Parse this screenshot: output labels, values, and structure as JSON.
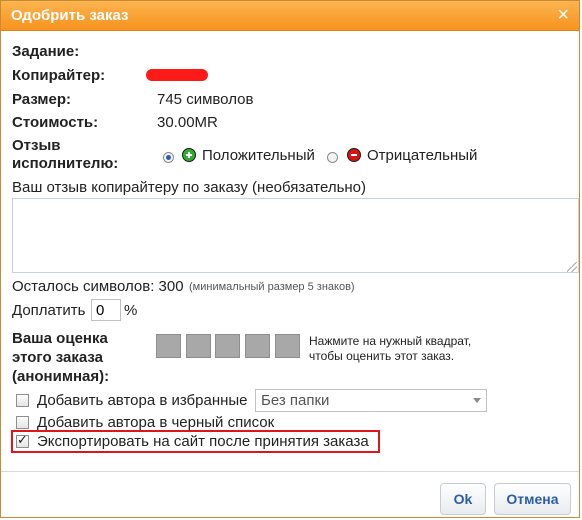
{
  "dialog": {
    "title": "Одобрить заказ",
    "close_glyph": "×"
  },
  "fields": {
    "task_label": "Задание:",
    "copywriter_label": "Копирайтер:",
    "size_label": "Размер:",
    "size_value": "745 символов",
    "cost_label": "Стоимость:",
    "cost_value": "30.00MR",
    "review_label_line1": "Отзыв",
    "review_label_line2": "исполнителю:",
    "positive_label": "Положительный",
    "negative_label": "Отрицательный",
    "review_positive_selected": true
  },
  "feedback": {
    "prompt": "Ваш отзыв копирайтеру по заказу (необязательно)",
    "value": "",
    "chars_left_label": "Осталось символов: 300",
    "chars_left_hint": "(минимальный размер 5 знаков)"
  },
  "extra_pay": {
    "label": "Доплатить",
    "value": "0",
    "unit": "%"
  },
  "rating": {
    "label_line1": "Ваша оценка",
    "label_line2": "этого заказа",
    "label_line3": "(анонимная):",
    "hint_line1": "Нажмите на нужный квадрат,",
    "hint_line2": "чтобы оценить этот заказ.",
    "squares": 5,
    "selected": 0
  },
  "options": {
    "favorites_label": "Добавить автора в избранные",
    "favorites_checked": false,
    "folder_value": "Без папки",
    "blacklist_label": "Добавить автора в черный список",
    "blacklist_checked": false,
    "export_label": "Экспортировать на сайт после принятия заказа",
    "export_checked": true
  },
  "buttons": {
    "ok": "Ok",
    "cancel": "Отмена"
  },
  "colors": {
    "titlebar": "#f7931e",
    "button_text": "#2a5caa",
    "highlight": "#e0151b"
  }
}
